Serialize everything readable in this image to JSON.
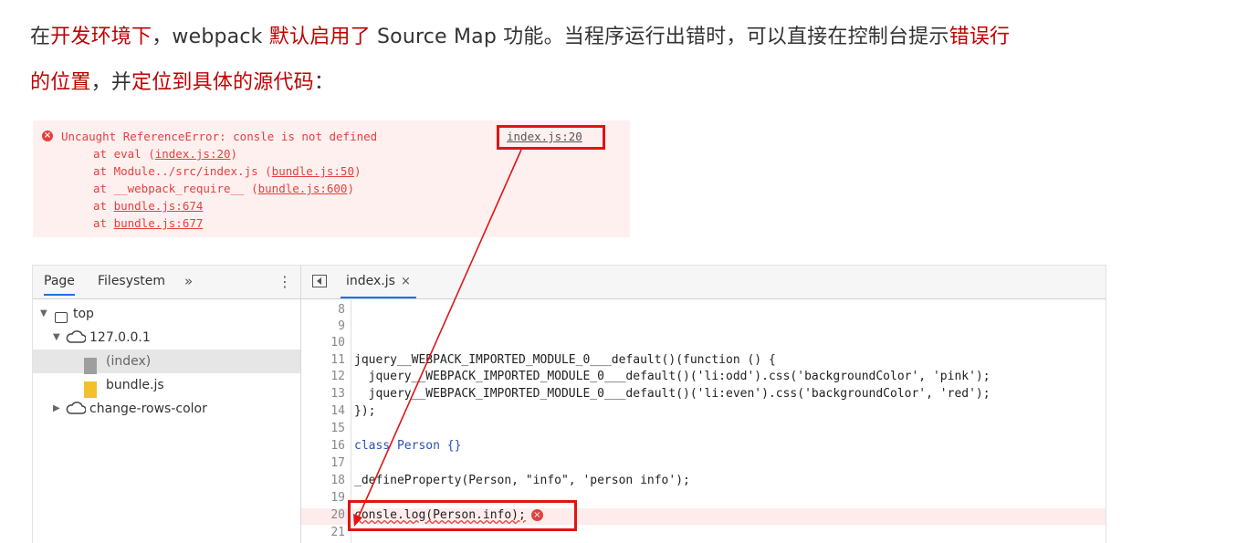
{
  "intro": {
    "line1": {
      "p1": "在",
      "h1": "开发环境下",
      "p2": "，webpack ",
      "h2": "默认启用了",
      "p3": " Source Map 功能。当程序运行出错时，可以直接在控制台提示",
      "h3": "错误行"
    },
    "line2": {
      "h1": "的位置",
      "p1": "，并",
      "h2": "定位到具体的源代码",
      "p2": "："
    }
  },
  "console": {
    "error_icon": "error-icon",
    "message": "Uncaught ReferenceError: consle is not defined",
    "source_link": "index.js:20",
    "stack": [
      {
        "prefix": "at eval (",
        "link": "index.js:20",
        "suffix": ")"
      },
      {
        "prefix": "at Module../src/index.js (",
        "link": "bundle.js:50",
        "suffix": ")"
      },
      {
        "prefix": "at __webpack_require__ (",
        "link": "bundle.js:600",
        "suffix": ")"
      },
      {
        "prefix": "at ",
        "link": "bundle.js:674",
        "suffix": ""
      },
      {
        "prefix": "at ",
        "link": "bundle.js:677",
        "suffix": ""
      }
    ]
  },
  "devtools": {
    "nav_tabs": [
      "Page",
      "Filesystem"
    ],
    "more_label": "»",
    "kebab_label": "⋮",
    "tree": [
      {
        "label": "top"
      },
      {
        "label": "127.0.0.1"
      },
      {
        "label": "(index)"
      },
      {
        "label": "bundle.js"
      },
      {
        "label": "change-rows-color"
      }
    ],
    "editor_tab": "index.js",
    "close_label": "×",
    "code_lines": [
      {
        "n": "8",
        "text": ""
      },
      {
        "n": "9",
        "text": ""
      },
      {
        "n": "10",
        "text": ""
      },
      {
        "n": "11",
        "text": "jquery__WEBPACK_IMPORTED_MODULE_0___default()(function () {"
      },
      {
        "n": "12",
        "text": "  jquery__WEBPACK_IMPORTED_MODULE_0___default()('li:odd').css('backgroundColor', 'pink');"
      },
      {
        "n": "13",
        "text": "  jquery__WEBPACK_IMPORTED_MODULE_0___default()('li:even').css('backgroundColor', 'red');"
      },
      {
        "n": "14",
        "text": "});"
      },
      {
        "n": "15",
        "text": ""
      },
      {
        "n": "16",
        "text": "class Person {}"
      },
      {
        "n": "17",
        "text": ""
      },
      {
        "n": "18",
        "text": "_defineProperty(Person, \"info\", 'person info');"
      },
      {
        "n": "19",
        "text": ""
      },
      {
        "n": "20",
        "text": "consle.log(Person.info);"
      },
      {
        "n": "21",
        "text": ""
      }
    ]
  },
  "colors": {
    "highlight": "#c00000",
    "annotation": "#e01414",
    "console_error": "#e2413e"
  }
}
